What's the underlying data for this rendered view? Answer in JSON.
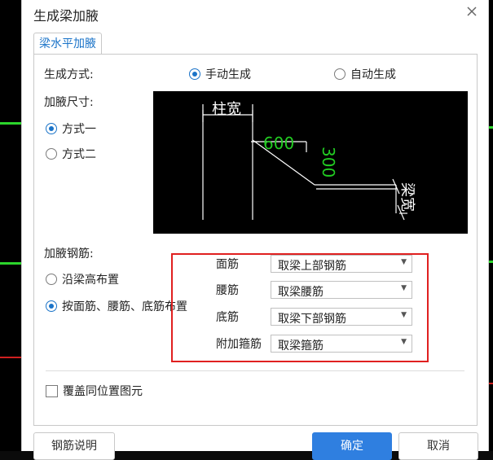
{
  "dialog": {
    "title": "生成梁加腋",
    "close_icon": "close-icon"
  },
  "tab": {
    "label": "梁水平加腋"
  },
  "mode": {
    "label": "生成方式:",
    "options": [
      {
        "label": "手动生成",
        "selected": true
      },
      {
        "label": "自动生成",
        "selected": false
      }
    ]
  },
  "size": {
    "label": "加腋尺寸:",
    "options": [
      {
        "label": "方式一",
        "selected": true
      },
      {
        "label": "方式二",
        "selected": false
      }
    ]
  },
  "diagram": {
    "column_width_label": "柱宽",
    "haunch_length": "600",
    "haunch_width": "300",
    "beam_width_label": "梁宽",
    "accent_color": "#22cc22"
  },
  "rebar": {
    "label": "加腋钢筋:",
    "options": [
      {
        "label": "沿梁高布置",
        "selected": false
      },
      {
        "label": "按面筋、腰筋、底筋布置",
        "selected": true
      }
    ],
    "fields": [
      {
        "label": "面筋",
        "value": "取梁上部钢筋"
      },
      {
        "label": "腰筋",
        "value": "取梁腰筋"
      },
      {
        "label": "底筋",
        "value": "取梁下部钢筋"
      },
      {
        "label": "附加箍筋",
        "value": "取梁箍筋"
      }
    ],
    "highlight_color": "#e02020"
  },
  "overwrite": {
    "label": "覆盖同位置图元",
    "checked": false
  },
  "buttons": {
    "help": "钢筋说明",
    "ok": "确定",
    "cancel": "取消"
  },
  "colors": {
    "primary": "#2f7fe0",
    "tab_text": "#1a73c8"
  }
}
